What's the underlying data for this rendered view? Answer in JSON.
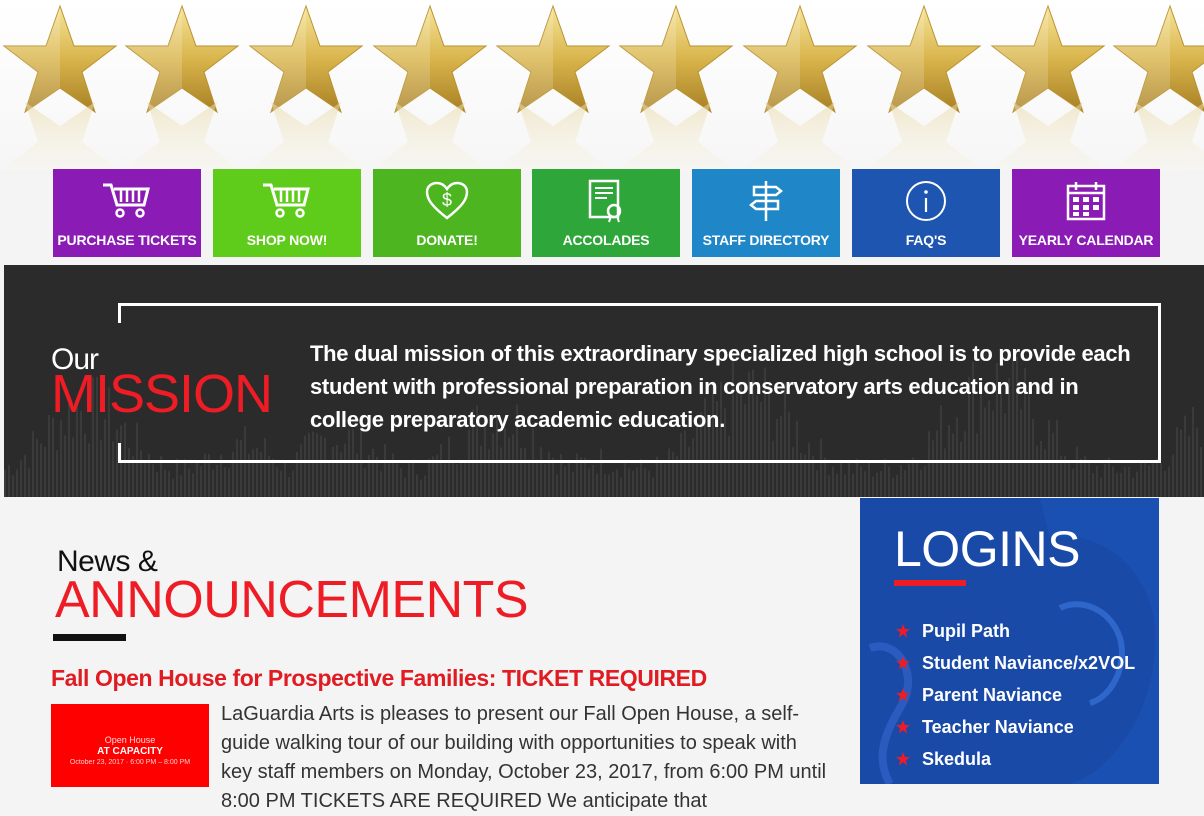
{
  "nav": [
    {
      "label": "PURCHASE TICKETS",
      "icon": "cart-icon",
      "color": "#8b1bb5"
    },
    {
      "label": "SHOP NOW!",
      "icon": "cart-icon",
      "color": "#5fcb1a"
    },
    {
      "label": "DONATE!",
      "icon": "heart-dollar-icon",
      "color": "#4cb520"
    },
    {
      "label": "ACCOLADES",
      "icon": "certificate-icon",
      "color": "#2fa63a"
    },
    {
      "label": "STAFF DIRECTORY",
      "icon": "signpost-icon",
      "color": "#1f86c8"
    },
    {
      "label": "FAQ'S",
      "icon": "info-icon",
      "color": "#1d55b0"
    },
    {
      "label": "YEARLY CALENDAR",
      "icon": "calendar-icon",
      "color": "#8b1bb5"
    }
  ],
  "mission": {
    "our": "Our",
    "word": "MISSION",
    "text": "The dual mission of this extraordinary specialized high school is to provide each student with professional preparation in conservatory arts education and in college preparatory academic education."
  },
  "news": {
    "small": "News &",
    "big": "ANNOUNCEMENTS",
    "article": {
      "title": "Fall Open House for Prospective Families: TICKET REQUIRED",
      "thumb_line1": "Open House",
      "thumb_line2": "AT CAPACITY",
      "thumb_line3": "October 23, 2017 · 6:00 PM – 8:00 PM",
      "body": "LaGuardia Arts is pleases to present our Fall Open House, a self-guide walking tour of our building with opportunities to speak with key staff members on Monday, October 23, 2017, from 6:00 PM until 8:00 PM TICKETS ARE REQUIRED We anticipate that"
    }
  },
  "logins": {
    "title": "LOGINS",
    "items": [
      "Pupil Path",
      "Student Naviance/x2VOL",
      "Parent Naviance",
      "Teacher Naviance",
      "Skedula"
    ]
  },
  "colors": {
    "red": "#ee1c24",
    "dark": "#2b2b2b",
    "blue": "#1a4aa8",
    "gold": "#d4b24a"
  }
}
